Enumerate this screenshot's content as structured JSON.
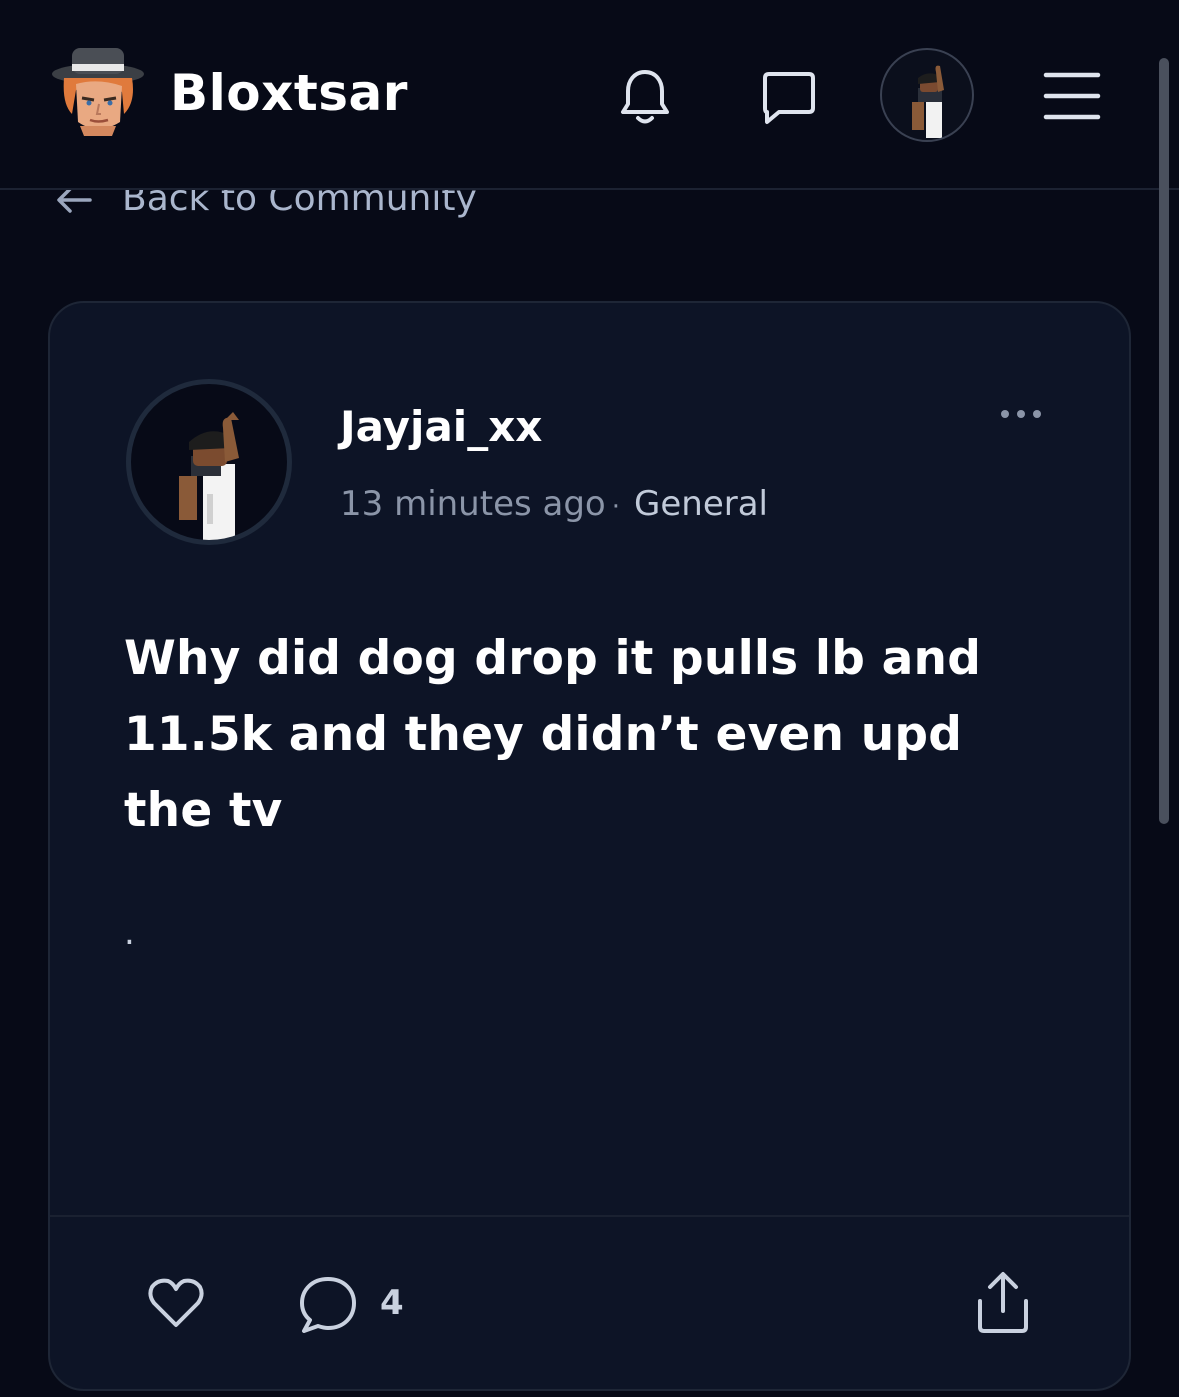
{
  "header": {
    "brand": "Bloxtsar",
    "icons": {
      "logo": "roblox-avatar-logo",
      "notifications": "bell-icon",
      "messages": "chat-icon",
      "profile": "user-avatar",
      "menu": "hamburger-menu-icon"
    }
  },
  "nav": {
    "back_label": "Back to Community"
  },
  "post": {
    "author": "Jayjai_xx",
    "time": "13 minutes ago",
    "separator": "·",
    "category": "General",
    "body": "Why did dog drop it pulls lb and 11.5k and they didn’t even upd the tv",
    "extra": ".",
    "comment_count": "4"
  },
  "colors": {
    "background": "#070a17",
    "card": "#0d1426",
    "muted_text": "#8b95a8",
    "accent_text": "#c1cad9"
  }
}
